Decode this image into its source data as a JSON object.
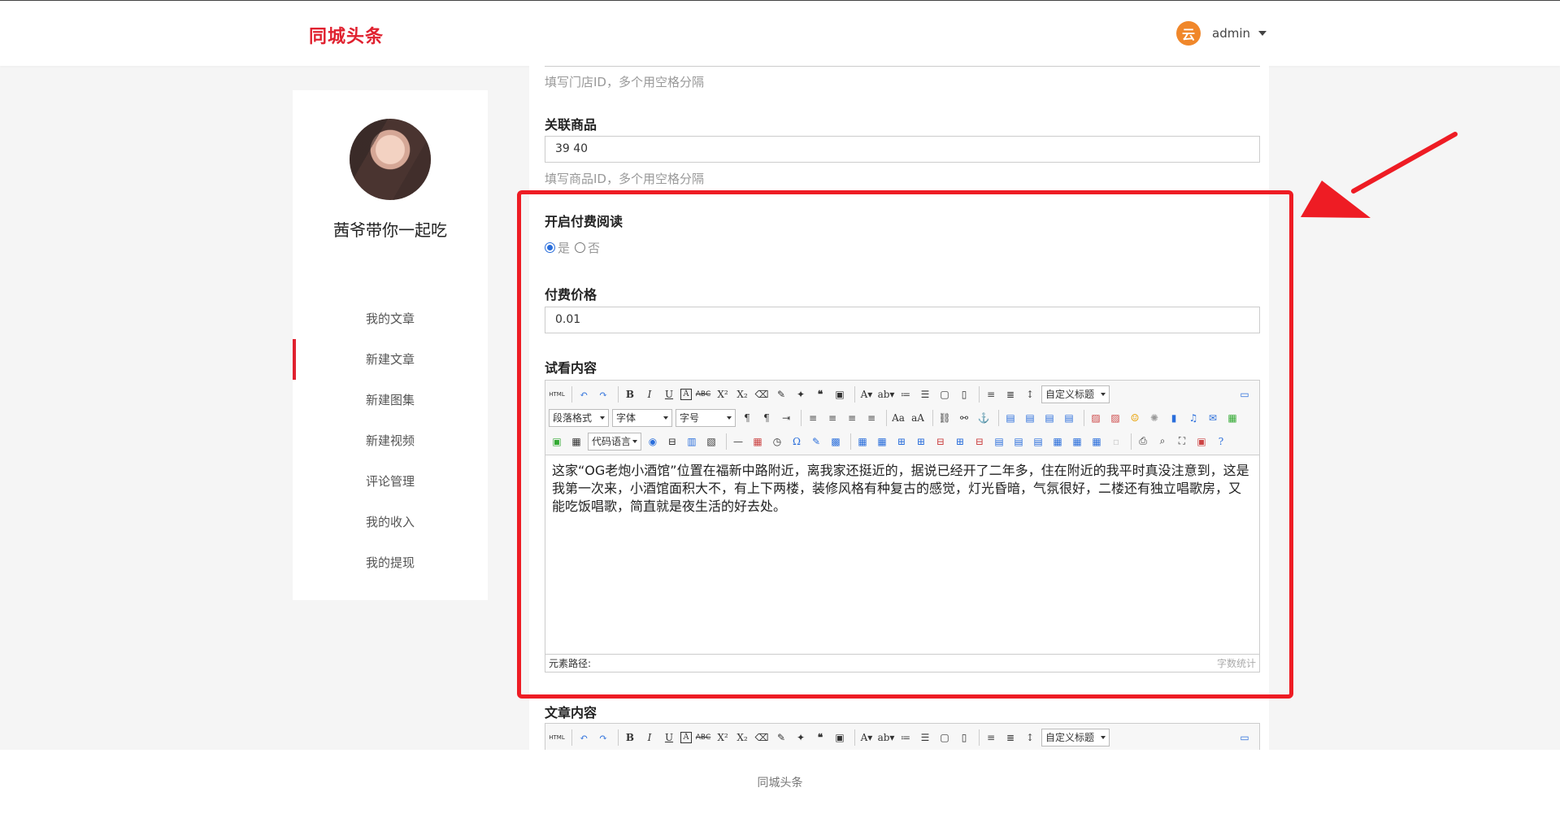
{
  "header": {
    "logo": "同城头条",
    "user_avatar_char": "云",
    "user_name": "admin"
  },
  "sidebar": {
    "profile_name": "茜爷带你一起吃",
    "menu": [
      {
        "label": "我的文章",
        "active": false
      },
      {
        "label": "新建文章",
        "active": true
      },
      {
        "label": "新建图集",
        "active": false
      },
      {
        "label": "新建视频",
        "active": false
      },
      {
        "label": "评论管理",
        "active": false
      },
      {
        "label": "我的收入",
        "active": false
      },
      {
        "label": "我的提现",
        "active": false
      }
    ]
  },
  "form": {
    "store_hint": "填写门店ID，多个用空格分隔",
    "goods_label": "关联商品",
    "goods_value": "39 40",
    "goods_hint": "填写商品ID，多个用空格分隔",
    "paid_label": "开启付费阅读",
    "paid_yes": "是",
    "paid_no": "否",
    "paid_selected": "是",
    "price_label": "付费价格",
    "price_value": "0.01",
    "preview_label": "试看内容",
    "preview_text": "这家“OG老炮小酒馆”位置在福新中路附近，离我家还挺近的，据说已经开了二年多，住在附近的我平时真没注意到，这是我第一次来，小酒馆面积大不，有上下两楼，装修风格有种复古的感觉，灯光昏暗，气氛很好，二楼还有独立唱歌房，又能吃饭唱歌，简直就是夜生活的好去处。",
    "content_label": "文章内容"
  },
  "editor": {
    "custom_title": "自定义标题",
    "paragraph_format": "段落格式",
    "font_family": "字体",
    "font_size": "字号",
    "code_language": "代码语言",
    "path_label": "元素路径:",
    "word_count": "字数统计"
  },
  "footer": {
    "text": "同城头条"
  },
  "colors": {
    "brand": "#e0212f",
    "highlight": "#ee1c24",
    "radio": "#2a6edb"
  }
}
